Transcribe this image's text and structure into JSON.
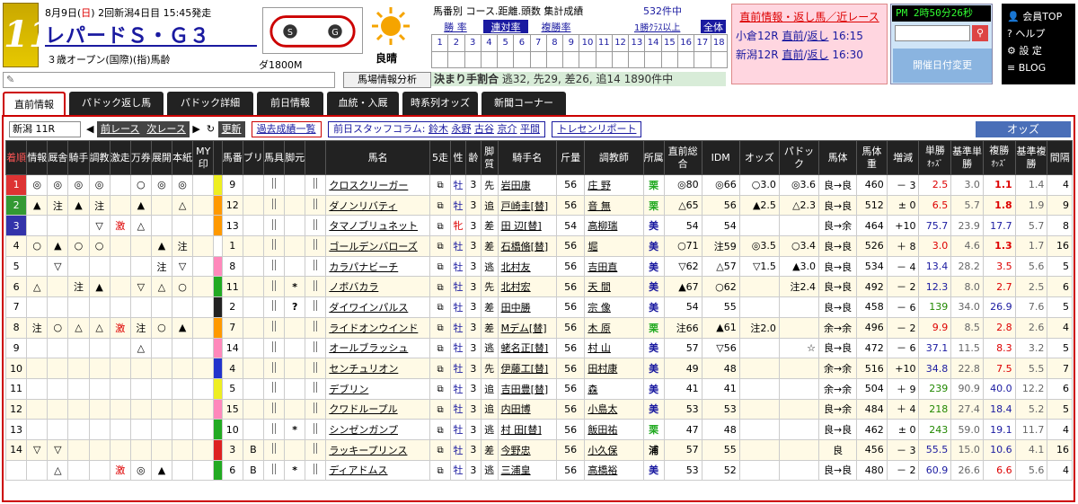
{
  "header": {
    "race_number": "11",
    "date_prefix": "8月9日(",
    "date_day": "日",
    "date_suffix": ") 2回新潟4日目 15:45発走",
    "title": "レパードＳ・Ｇ３",
    "condition": "３歳オープン(国際)(指)馬齢",
    "distance": "ダ1800M",
    "weather": "良晴",
    "analysis_button": "馬場情報分析"
  },
  "stats": {
    "title": "馬番別 コース.距離.頭数 集計成績",
    "count": "532件中",
    "tabs": [
      "勝 率",
      "連対率",
      "複勝率"
    ],
    "class_link": "1勝ｸﾗｽ以上",
    "all_label": "全体",
    "numbers": [
      "1",
      "2",
      "3",
      "4",
      "5",
      "6",
      "7",
      "8",
      "9",
      "10",
      "11",
      "12",
      "13",
      "14",
      "15",
      "16",
      "17",
      "18"
    ],
    "pace_label": "決まり手割合",
    "pace_values": " 逃32, 先29, 差26, 追14   1890件中"
  },
  "direct": {
    "header": "直前情報・返し馬／近レース",
    "rows": [
      {
        "race": "小倉12R",
        "link1": "直前",
        "link2": "返し",
        "time": "16:15"
      },
      {
        "race": "新潟12R",
        "link1": "直前",
        "link2": "返し",
        "time": "16:30"
      }
    ]
  },
  "clock": {
    "prefix": "PM",
    "time": "2時50分26秒",
    "date_change": "開催日付変更"
  },
  "member_menu": [
    "会員TOP",
    "ヘルプ",
    "設 定",
    "BLOG"
  ],
  "tabs": [
    "直前情報",
    "パドック返し馬",
    "パドック詳細",
    "前日情報",
    "血統・入厩",
    "時系列オッズ",
    "新聞コーナー"
  ],
  "toolbar": {
    "race_select": "新潟 11R",
    "prev": "前レース",
    "next": "次レース",
    "refresh": "更新",
    "past": "過去成績一覧",
    "column_prefix": "前日スタッフコラム:",
    "staff": [
      "鈴木",
      "永野",
      "古谷",
      "京介",
      "平間"
    ],
    "training": "トレセンリポート",
    "odds": "オッズ"
  },
  "columns": {
    "arrival": "着順",
    "info": "情報",
    "stable": "厩舎",
    "rider": "騎手",
    "training": "調教",
    "gekiso": "激走",
    "manken": "万券",
    "tenkai": "展開",
    "honshi": "本紙",
    "my": "MY印",
    "umaban": "馬番",
    "blinker": "ブリ",
    "gear": "馬具",
    "foot": "脚元",
    "name": "馬名",
    "ago": "5走",
    "sex": "性",
    "age": "齢",
    "style": "脚質",
    "jockey": "騎手名",
    "weight": "斤量",
    "trainer": "調教師",
    "affil": "所属",
    "overall": "直前総合",
    "idm": "IDM",
    "odds": "オッズ",
    "paddock": "パドック",
    "body": "馬体",
    "bodyw": "馬体重",
    "diff": "増減",
    "win": "単勝",
    "win_sub": "ｵｯｽﾞ",
    "bwin": "基準単勝",
    "place": "複勝",
    "place_sub": "ｵｯｽﾞ",
    "bplace": "基準複勝",
    "gap": "間隔"
  },
  "rows": [
    {
      "arr": "1",
      "info": "◎",
      "stb": "◎",
      "rid": "◎",
      "trn": "◎",
      "gek": "",
      "man": "○",
      "ten": "◎",
      "hon": "◎",
      "my": "",
      "num": "9",
      "bli": "",
      "gear": "",
      "foot": "",
      "name": "クロスクリーガー",
      "sex": "牡",
      "age": "3",
      "sty": "先",
      "jky": "岩田康",
      "wt": "56",
      "tr": "庄 野",
      "af": "栗",
      "ov": "◎80",
      "idm": "◎66",
      "odd": "○3.0",
      "pad": "◎3.6",
      "body": "良→良",
      "bw": "460",
      "df": "－ 3",
      "win": "2.5",
      "bwin": "3.0",
      "plc": "1.1",
      "bplc": "1.4",
      "gap": "4"
    },
    {
      "arr": "2",
      "info": "▲",
      "stb": "注",
      "rid": "▲",
      "trn": "注",
      "gek": "",
      "man": "▲",
      "ten": "",
      "hon": "△",
      "my": "",
      "num": "12",
      "bli": "",
      "gear": "",
      "foot": "",
      "name": "ダノンリバティ",
      "sex": "牡",
      "age": "3",
      "sty": "追",
      "jky": "戸崎圭[替]",
      "wt": "56",
      "tr": "音 無",
      "af": "栗",
      "ov": "△65",
      "idm": "56",
      "odd": "▲2.5",
      "pad": "△2.3",
      "body": "良→良",
      "bw": "512",
      "df": "± 0",
      "win": "6.5",
      "bwin": "5.7",
      "plc": "1.8",
      "bplc": "1.9",
      "gap": "9"
    },
    {
      "arr": "3",
      "info": "",
      "stb": "",
      "rid": "",
      "trn": "▽",
      "gek": "激",
      "man": "△",
      "ten": "",
      "hon": "",
      "my": "",
      "num": "13",
      "bli": "",
      "gear": "",
      "foot": "",
      "name": "タマノブリュネット",
      "sex": "牝",
      "age": "3",
      "sty": "差",
      "jky": "田 辺[替]",
      "wt": "54",
      "tr": "高柳瑞",
      "af": "美",
      "ov": "54",
      "idm": "54",
      "odd": "",
      "pad": "",
      "body": "良→余",
      "bw": "464",
      "df": "+10",
      "win": "75.7",
      "bwin": "23.9",
      "plc": "17.7",
      "bplc": "5.7",
      "gap": "8"
    },
    {
      "arr": "4",
      "info": "○",
      "stb": "▲",
      "rid": "○",
      "trn": "○",
      "gek": "",
      "man": "",
      "ten": "▲",
      "hon": "注",
      "my": "",
      "num": "1",
      "bli": "",
      "gear": "",
      "foot": "",
      "name": "ゴールデンバローズ",
      "sex": "牡",
      "age": "3",
      "sty": "差",
      "jky": "石橋脩[替]",
      "wt": "56",
      "tr": "堀",
      "af": "美",
      "ov": "○71",
      "idm": "注59",
      "odd": "◎3.5",
      "pad": "○3.4",
      "body": "良→良",
      "bw": "526",
      "df": "＋ 8",
      "win": "3.0",
      "bwin": "4.6",
      "plc": "1.3",
      "bplc": "1.7",
      "gap": "16"
    },
    {
      "arr": "5",
      "info": "",
      "stb": "▽",
      "rid": "",
      "trn": "",
      "gek": "",
      "man": "",
      "ten": "注",
      "hon": "▽",
      "my": "",
      "num": "8",
      "bli": "",
      "gear": "",
      "foot": "",
      "name": "カラパナビーチ",
      "sex": "牡",
      "age": "3",
      "sty": "逃",
      "jky": "北村友",
      "wt": "56",
      "tr": "吉田直",
      "af": "美",
      "ov": "▽62",
      "idm": "△57",
      "odd": "▽1.5",
      "pad": "▲3.0",
      "body": "良→良",
      "bw": "534",
      "df": "－ 4",
      "win": "13.4",
      "bwin": "28.2",
      "plc": "3.5",
      "bplc": "5.6",
      "gap": "5"
    },
    {
      "arr": "6",
      "info": "△",
      "stb": "",
      "rid": "注",
      "trn": "▲",
      "gek": "",
      "man": "▽",
      "ten": "△",
      "hon": "○",
      "my": "",
      "num": "11",
      "bli": "",
      "gear": "",
      "foot": "*",
      "name": "ノボバカラ",
      "sex": "牡",
      "age": "3",
      "sty": "先",
      "jky": "北村宏",
      "wt": "56",
      "tr": "天 間",
      "af": "美",
      "ov": "▲67",
      "idm": "○62",
      "odd": "",
      "pad": "注2.4",
      "body": "良→良",
      "bw": "492",
      "df": "－ 2",
      "win": "12.3",
      "bwin": "8.0",
      "plc": "2.7",
      "bplc": "2.5",
      "gap": "6"
    },
    {
      "arr": "7",
      "info": "",
      "stb": "",
      "rid": "",
      "trn": "",
      "gek": "",
      "man": "",
      "ten": "",
      "hon": "",
      "my": "",
      "num": "2",
      "bli": "",
      "gear": "",
      "foot": "?",
      "name": "ダイワインパルス",
      "sex": "牡",
      "age": "3",
      "sty": "差",
      "jky": "田中勝",
      "wt": "56",
      "tr": "宗 像",
      "af": "美",
      "ov": "54",
      "idm": "55",
      "odd": "",
      "pad": "",
      "body": "良→良",
      "bw": "458",
      "df": "－ 6",
      "win": "139",
      "bwin": "34.0",
      "plc": "26.9",
      "bplc": "7.6",
      "gap": "5"
    },
    {
      "arr": "8",
      "info": "注",
      "stb": "○",
      "rid": "△",
      "trn": "△",
      "gek": "激",
      "man": "注",
      "ten": "○",
      "hon": "▲",
      "my": "",
      "num": "7",
      "bli": "",
      "gear": "",
      "foot": "",
      "name": "ライドオンウインド",
      "sex": "牡",
      "age": "3",
      "sty": "差",
      "jky": "Mデム[替]",
      "wt": "56",
      "tr": "木 原",
      "af": "栗",
      "ov": "注66",
      "idm": "▲61",
      "odd": "注2.0",
      "pad": "",
      "body": "余→余",
      "bw": "496",
      "df": "－ 2",
      "win": "9.9",
      "bwin": "8.5",
      "plc": "2.8",
      "bplc": "2.6",
      "gap": "4"
    },
    {
      "arr": "9",
      "info": "",
      "stb": "",
      "rid": "",
      "trn": "",
      "gek": "",
      "man": "△",
      "ten": "",
      "hon": "",
      "my": "",
      "num": "14",
      "bli": "",
      "gear": "",
      "foot": "",
      "name": "オールブラッシュ",
      "sex": "牡",
      "age": "3",
      "sty": "逃",
      "jky": "蛯名正[替]",
      "wt": "56",
      "tr": "村 山",
      "af": "美",
      "ov": "57",
      "idm": "▽56",
      "odd": "",
      "pad": "☆",
      "body": "良→良",
      "bw": "472",
      "df": "－ 6",
      "win": "37.1",
      "bwin": "11.5",
      "plc": "8.3",
      "bplc": "3.2",
      "gap": "5"
    },
    {
      "arr": "10",
      "info": "",
      "stb": "",
      "rid": "",
      "trn": "",
      "gek": "",
      "man": "",
      "ten": "",
      "hon": "",
      "my": "",
      "num": "4",
      "bli": "",
      "gear": "",
      "foot": "",
      "name": "センチュリオン",
      "sex": "牡",
      "age": "3",
      "sty": "先",
      "jky": "伊藤工[替]",
      "wt": "56",
      "tr": "田村康",
      "af": "美",
      "ov": "49",
      "idm": "48",
      "odd": "",
      "pad": "",
      "body": "余→余",
      "bw": "516",
      "df": "+10",
      "win": "34.8",
      "bwin": "22.8",
      "plc": "7.5",
      "bplc": "5.5",
      "gap": "7"
    },
    {
      "arr": "11",
      "info": "",
      "stb": "",
      "rid": "",
      "trn": "",
      "gek": "",
      "man": "",
      "ten": "",
      "hon": "",
      "my": "",
      "num": "5",
      "bli": "",
      "gear": "",
      "foot": "",
      "name": "デブリン",
      "sex": "牡",
      "age": "3",
      "sty": "追",
      "jky": "吉田豊[替]",
      "wt": "56",
      "tr": "森",
      "af": "美",
      "ov": "41",
      "idm": "41",
      "odd": "",
      "pad": "",
      "body": "余→余",
      "bw": "504",
      "df": "＋ 9",
      "win": "239",
      "bwin": "90.9",
      "plc": "40.0",
      "bplc": "12.2",
      "gap": "6"
    },
    {
      "arr": "12",
      "info": "",
      "stb": "",
      "rid": "",
      "trn": "",
      "gek": "",
      "man": "",
      "ten": "",
      "hon": "",
      "my": "",
      "num": "15",
      "bli": "",
      "gear": "",
      "foot": "",
      "name": "クワドループル",
      "sex": "牡",
      "age": "3",
      "sty": "追",
      "jky": "内田博",
      "wt": "56",
      "tr": "小島太",
      "af": "美",
      "ov": "53",
      "idm": "53",
      "odd": "",
      "pad": "",
      "body": "良→余",
      "bw": "484",
      "df": "＋ 4",
      "win": "218",
      "bwin": "27.4",
      "plc": "18.4",
      "bplc": "5.2",
      "gap": "5"
    },
    {
      "arr": "13",
      "info": "",
      "stb": "",
      "rid": "",
      "trn": "",
      "gek": "",
      "man": "",
      "ten": "",
      "hon": "",
      "my": "",
      "num": "10",
      "bli": "",
      "gear": "",
      "foot": "*",
      "name": "シンゼンガンプ",
      "sex": "牡",
      "age": "3",
      "sty": "逃",
      "jky": "村 田[替]",
      "wt": "56",
      "tr": "飯田祐",
      "af": "栗",
      "ov": "47",
      "idm": "48",
      "odd": "",
      "pad": "",
      "body": "良→良",
      "bw": "462",
      "df": "± 0",
      "win": "243",
      "bwin": "59.0",
      "plc": "19.1",
      "bplc": "11.7",
      "gap": "4"
    },
    {
      "arr": "14",
      "info": "▽",
      "stb": "▽",
      "rid": "",
      "trn": "",
      "gek": "",
      "man": "",
      "ten": "",
      "hon": "",
      "my": "",
      "num": "3",
      "bli": "B",
      "gear": "",
      "foot": "",
      "name": "ラッキープリンス",
      "sex": "牡",
      "age": "3",
      "sty": "差",
      "jky": "今野忠",
      "wt": "56",
      "tr": "小久保",
      "af": "浦",
      "ov": "57",
      "idm": "55",
      "odd": "",
      "pad": "",
      "body": "良",
      "bw": "456",
      "df": "－ 3",
      "win": "55.5",
      "bwin": "15.0",
      "plc": "10.6",
      "bplc": "4.1",
      "gap": "16"
    },
    {
      "arr": "",
      "info": "",
      "stb": "△",
      "rid": "",
      "trn": "",
      "gek": "激",
      "man": "◎",
      "ten": "▲",
      "hon": "",
      "my": "",
      "num": "6",
      "bli": "B",
      "gear": "",
      "foot": "*",
      "name": "ディアドムス",
      "sex": "牡",
      "age": "3",
      "sty": "逃",
      "jky": "三浦皇",
      "wt": "56",
      "tr": "高橋裕",
      "af": "美",
      "ov": "53",
      "idm": "52",
      "odd": "",
      "pad": "",
      "body": "良→良",
      "bw": "480",
      "df": "－ 2",
      "win": "60.9",
      "bwin": "26.6",
      "plc": "6.6",
      "bplc": "5.6",
      "gap": "4"
    }
  ],
  "colors": {
    "accent": "#c00000",
    "header_bg": "#222222",
    "link": "#1a1aa0"
  }
}
